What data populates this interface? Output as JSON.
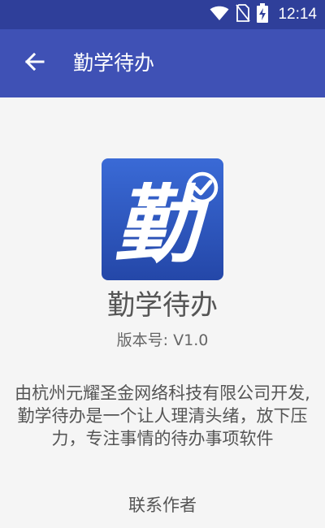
{
  "status_bar": {
    "time": "12:14",
    "icons": [
      "wifi-icon",
      "no-sim-icon",
      "battery-charging-icon"
    ]
  },
  "app_bar": {
    "back_icon": "arrow-back-icon",
    "title": "勤学待办"
  },
  "about": {
    "logo_icon": "app-logo-icon",
    "logo_char": "勤",
    "app_name": "勤学待办",
    "version": "版本号: V1.0",
    "description": "由杭州元耀圣金网络科技有限公司开发,勤学待办是一个让人理清头绪，放下压力，专注事情的待办事项软件",
    "contact_label": "联系作者"
  },
  "colors": {
    "status_bar": "#2f3f9a",
    "app_bar": "#3f51b5",
    "background": "#f5f5f5",
    "logo_background": "#2c57c0",
    "text": "#555555"
  }
}
